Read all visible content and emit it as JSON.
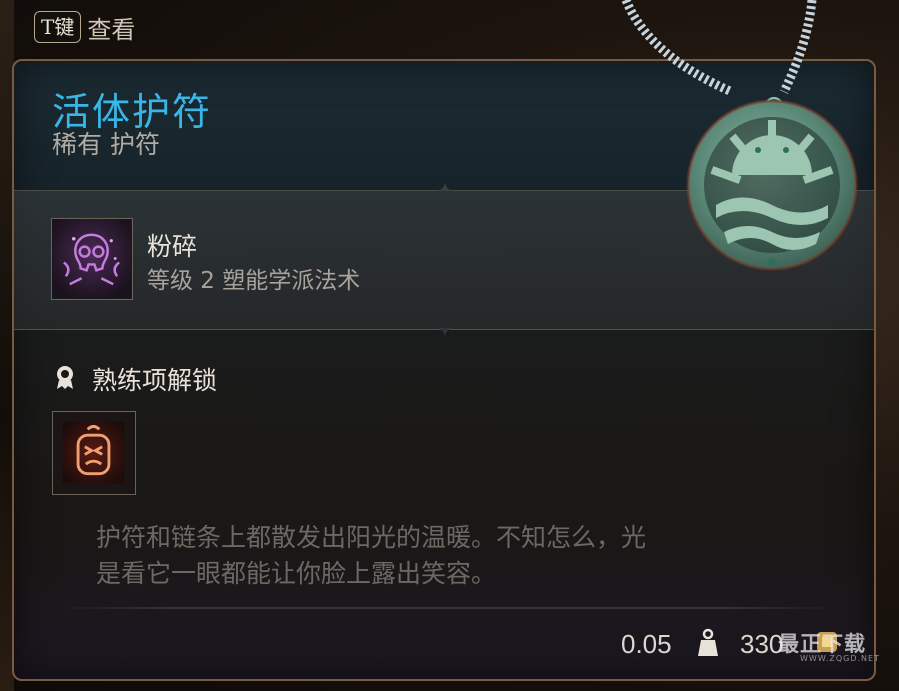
{
  "hint": {
    "key": "T键",
    "label": "查看"
  },
  "item": {
    "name": "活体护符",
    "rarity_type": "稀有 护符",
    "name_color": "#39b6e8"
  },
  "spell": {
    "icon": "shatter-skull-icon",
    "name": "粉碎",
    "detail": "等级 2 塑能学派法术"
  },
  "proficiency": {
    "icon": "ribbon-badge-icon",
    "title": "熟练项解锁",
    "item_icon": "amulet-proficiency-icon"
  },
  "description": {
    "line1": "护符和链条上都散发出阳光的温暖。不知怎么，光",
    "line2": "是看它一眼都能让你脸上露出笑容。"
  },
  "footer": {
    "weight": "0.05",
    "weight_icon": "weight-icon",
    "gold": "330",
    "gold_icon": "gold-coin-icon"
  },
  "watermark": {
    "text": "最正下载",
    "sub": "WWW.ZQGD.NET"
  }
}
